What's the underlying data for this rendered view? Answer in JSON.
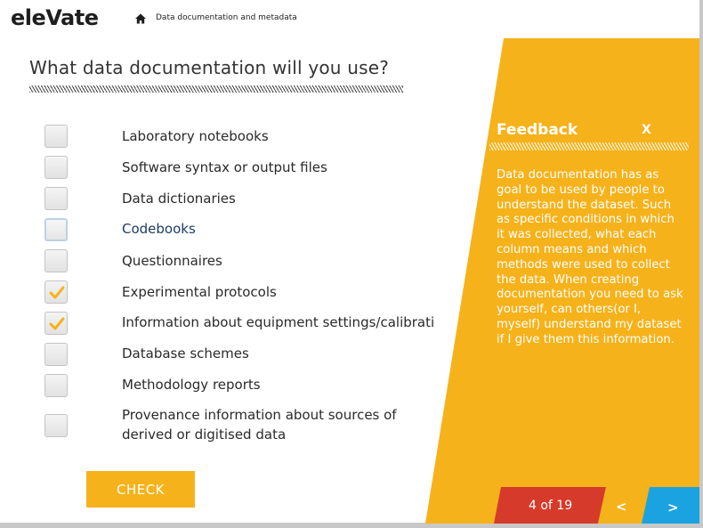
{
  "header": {
    "logo_text": "eleVate",
    "breadcrumb": "Data documentation and metadata",
    "home_icon": "home-icon"
  },
  "question": {
    "title": "What data documentation will you use?"
  },
  "options": [
    {
      "label": "Laboratory notebooks",
      "checked": false
    },
    {
      "label": "Software syntax or output files",
      "checked": false
    },
    {
      "label": "Data dictionaries",
      "checked": false
    },
    {
      "label": "Codebooks",
      "checked": false,
      "focused": true
    },
    {
      "label": "Questionnaires",
      "checked": false
    },
    {
      "label": "Experimental protocols",
      "checked": true
    },
    {
      "label": "Information about equipment settings/calibrati",
      "checked": true
    },
    {
      "label": "Database schemes",
      "checked": false
    },
    {
      "label": "Methodology reports",
      "checked": false
    },
    {
      "label": "Provenance information about sources of derived or digitised data",
      "checked": false
    }
  ],
  "check_button": {
    "label": "CHECK"
  },
  "feedback": {
    "title": "Feedback",
    "close_label": "X",
    "text": "Data documentation has as goal to be used by people to understand the dataset. Such as specific conditions in which it was collected, what each column means and which methods were used to collect the data. When creating documentation you need to ask yourself, can others(or I, myself) understand my dataset if I give them this information."
  },
  "pager": {
    "text": "4 of 19",
    "prev_label": "<",
    "next_label": ">"
  },
  "colors": {
    "accent": "#f6b21b",
    "pager_red": "#d63a2a",
    "pager_blue": "#1aa3e0",
    "checkmark": "#f6b21b"
  }
}
